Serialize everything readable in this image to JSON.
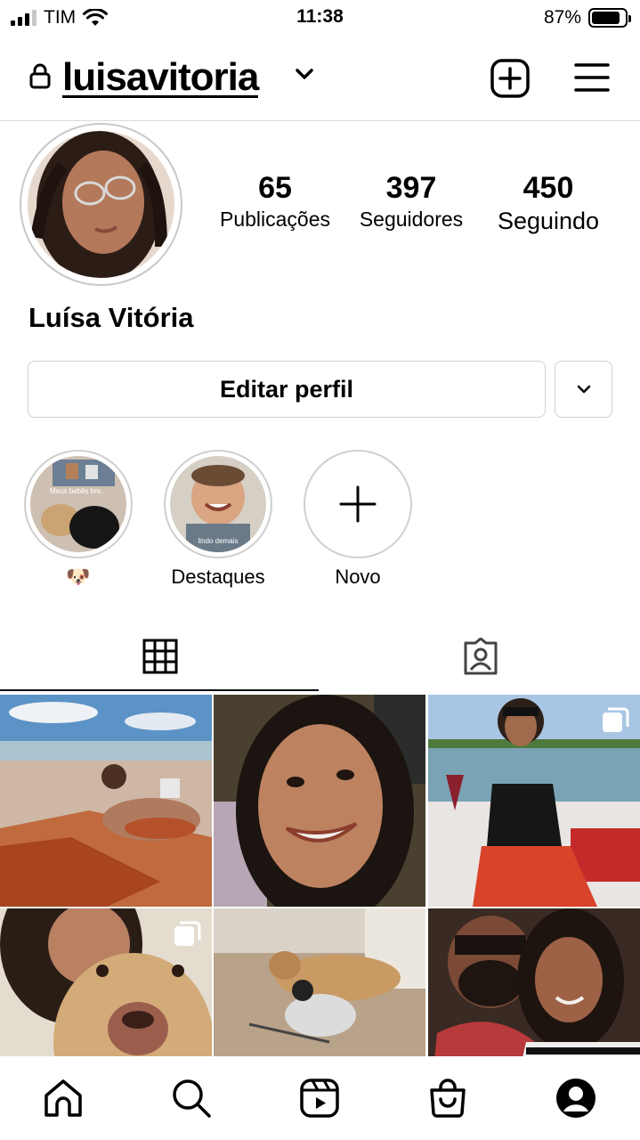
{
  "status_bar": {
    "carrier": "TIM",
    "time": "11:38",
    "battery": "87%",
    "battery_level": 0.87
  },
  "header": {
    "username": "luisavitoria",
    "icons": [
      "lock-icon",
      "chevron-down-icon",
      "new-post-icon",
      "menu-icon"
    ]
  },
  "profile": {
    "full_name": "Luísa Vitória",
    "stats": [
      {
        "value": "65",
        "label": "Publicações"
      },
      {
        "value": "397",
        "label": "Seguidores"
      },
      {
        "value": "450",
        "label": "Seguindo"
      }
    ],
    "edit_label": "Editar perfil"
  },
  "highlights": [
    {
      "label": "🐶",
      "caption": "Meus bebês bre..."
    },
    {
      "label": "Destaques",
      "caption": "lindo demais"
    },
    {
      "label": "Novo"
    }
  ],
  "tabs": [
    {
      "icon": "grid-icon",
      "active": true
    },
    {
      "icon": "tagged-icon",
      "active": false
    }
  ],
  "posts": [
    {
      "description": "beach",
      "multi": false
    },
    {
      "description": "selfie",
      "multi": false
    },
    {
      "description": "boat",
      "multi": true
    },
    {
      "description": "dog-selfie",
      "multi": true
    },
    {
      "description": "dogs",
      "multi": false
    },
    {
      "description": "couple",
      "multi": false
    }
  ],
  "bottom_nav": [
    "home-icon",
    "search-icon",
    "reels-icon",
    "shop-icon",
    "profile-icon"
  ]
}
